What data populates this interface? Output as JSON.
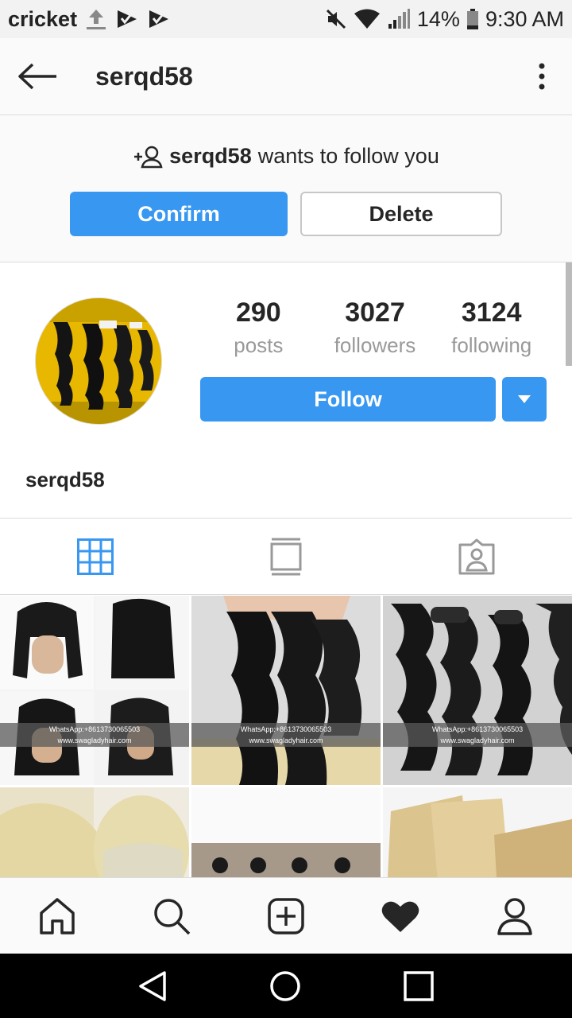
{
  "status_bar": {
    "carrier": "cricket",
    "battery": "14%",
    "time": "9:30 AM"
  },
  "app_bar": {
    "title": "serqd58"
  },
  "follow_request": {
    "username": "serqd58",
    "message": "wants to follow you",
    "confirm_label": "Confirm",
    "delete_label": "Delete"
  },
  "profile": {
    "posts_count": "290",
    "posts_label": "posts",
    "followers_count": "3027",
    "followers_label": "followers",
    "following_count": "3124",
    "following_label": "following",
    "follow_label": "Follow",
    "username": "serqd58"
  },
  "grid": {
    "watermark_line1": "WhatsApp:+8613730065503",
    "watermark_line2": "www.swagladyhair.com"
  },
  "icons": {
    "back": "arrow-left-icon",
    "more": "more-vertical-icon",
    "grid_tab": "grid-icon",
    "feed_tab": "feed-icon",
    "tagged_tab": "tagged-icon",
    "home": "home-icon",
    "search": "search-icon",
    "add": "add-post-icon",
    "activity": "heart-icon",
    "profile": "profile-icon"
  },
  "colors": {
    "accent": "#3897f0",
    "status_bar_bg": "#f2f2f2",
    "sys_nav_bg": "#000000"
  }
}
